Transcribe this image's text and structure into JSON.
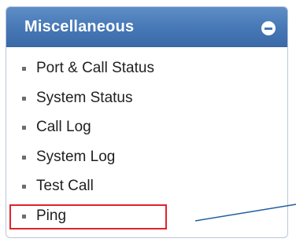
{
  "panel": {
    "title": "Miscellaneous",
    "collapse_icon": "minus-circle-icon",
    "items": [
      {
        "label": "Port & Call Status"
      },
      {
        "label": "System Status"
      },
      {
        "label": "Call Log"
      },
      {
        "label": "System Log"
      },
      {
        "label": "Test Call"
      },
      {
        "label": "Ping"
      }
    ]
  },
  "annotation": {
    "highlighted_item": "Ping",
    "highlight_color": "#e0232b",
    "pointer_color": "#1f5f9e"
  },
  "colors": {
    "header": "#4677b5",
    "border": "#b9c8dc",
    "text": "#1f1f1f"
  }
}
